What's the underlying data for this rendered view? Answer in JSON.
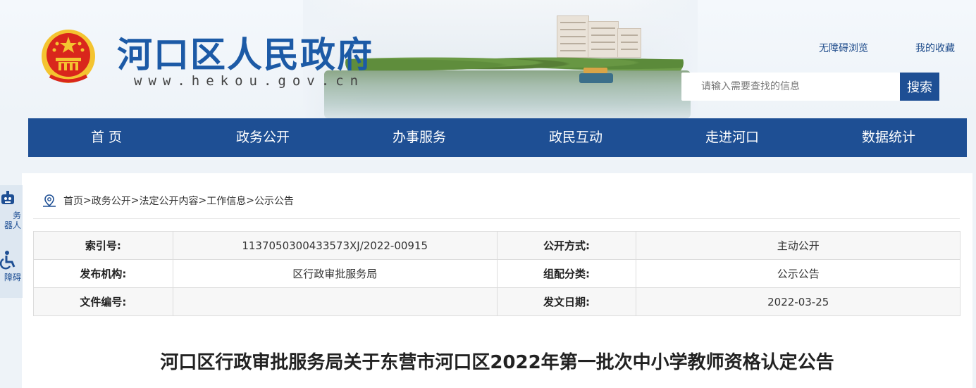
{
  "header": {
    "site_title": "河口区人民政府",
    "site_url": "www.hekou.gov.cn",
    "links": {
      "accessibility": "无障碍浏览",
      "favorites": "我的收藏"
    },
    "search": {
      "placeholder": "请输入需要查找的信息",
      "button": "搜索"
    }
  },
  "nav": [
    "首 页",
    "政务公开",
    "办事服务",
    "政民互动",
    "走进河口",
    "数据统计"
  ],
  "side_float": {
    "robot": "政务\n器人",
    "accessibility": "障碍"
  },
  "breadcrumb": [
    "首页",
    "政务公开",
    "法定公开内容",
    "工作信息",
    "公示公告"
  ],
  "breadcrumb_sep": ">",
  "meta": {
    "rows": [
      {
        "k1": "索引号:",
        "v1": "1137050300433573XJ/2022-00915",
        "k2": "公开方式:",
        "v2": "主动公开"
      },
      {
        "k1": "发布机构:",
        "v1": "区行政审批服务局",
        "k2": "组配分类:",
        "v2": "公示公告"
      },
      {
        "k1": "文件编号:",
        "v1": "",
        "k2": "发文日期:",
        "v2": "2022-03-25"
      }
    ]
  },
  "article": {
    "title": "河口区行政审批服务局关于东营市河口区2022年第一批次中小学教师资格认定公告"
  },
  "colors": {
    "brand_blue": "#1e4f94",
    "title_blue": "#1c5aa6",
    "emblem_red": "#d9261c",
    "emblem_gold": "#f4c430"
  }
}
